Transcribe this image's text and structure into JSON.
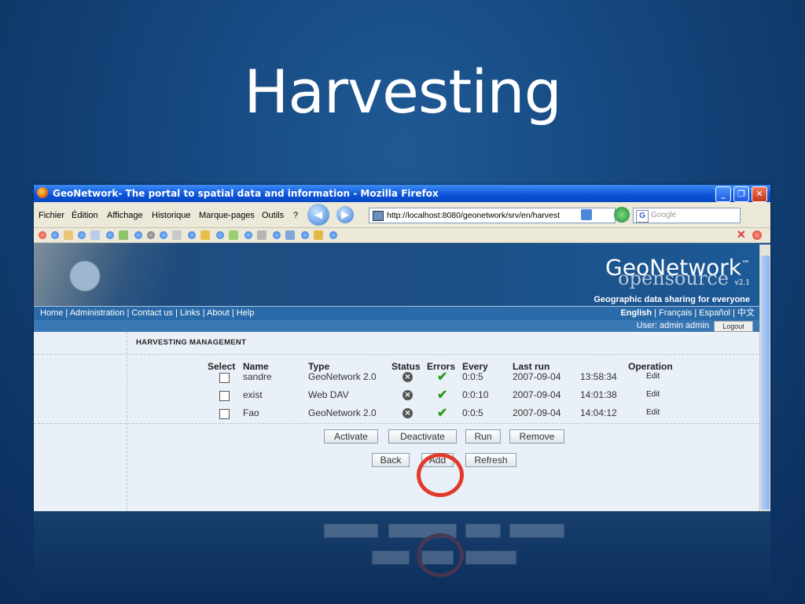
{
  "slide": {
    "title": "Harvesting"
  },
  "window": {
    "title": "GeoNetwork- The portal to spatial data and information - Mozilla Firefox",
    "menu": [
      "Fichier",
      "Édition",
      "Affichage",
      "Historique",
      "Marque-pages",
      "Outils",
      "?"
    ],
    "url": "http://localhost:8080/geonetwork/srv/en/harvest",
    "search_placeholder": "Google"
  },
  "site": {
    "brand": "GeoNetwork",
    "trademark": "™",
    "sub": "opensource",
    "version": "v2.1",
    "tagline": "Geographic data sharing for everyone",
    "nav": [
      "Home",
      "Administration",
      "Contact us",
      "Links",
      "About",
      "Help"
    ],
    "languages": [
      "English",
      "Français",
      "Español",
      "中文"
    ],
    "user": "User: admin admin",
    "logout": "Logout"
  },
  "harvesting": {
    "section_title": "HARVESTING MANAGEMENT",
    "columns": [
      "Select",
      "Name",
      "Type",
      "Status",
      "Errors",
      "Every",
      "Last run",
      "Operation"
    ],
    "rows": [
      {
        "name": "sandre",
        "type": "GeoNetwork 2.0",
        "every": "0:0:5",
        "last_date": "2007-09-04",
        "last_time": "13:58:34",
        "op": "Edit"
      },
      {
        "name": "exist",
        "type": "Web DAV",
        "every": "0:0:10",
        "last_date": "2007-09-04",
        "last_time": "14:01:38",
        "op": "Edit"
      },
      {
        "name": "Fao",
        "type": "GeoNetwork 2.0",
        "every": "0:0:5",
        "last_date": "2007-09-04",
        "last_time": "14:04:12",
        "op": "Edit"
      }
    ],
    "buttons_row1": [
      "Activate",
      "Deactivate",
      "Run",
      "Remove"
    ],
    "buttons_row2": [
      "Back",
      "Add",
      "Refresh"
    ]
  },
  "colors": {
    "highlight_circle": "#e23a2a",
    "slide_bg": "#14457c"
  }
}
